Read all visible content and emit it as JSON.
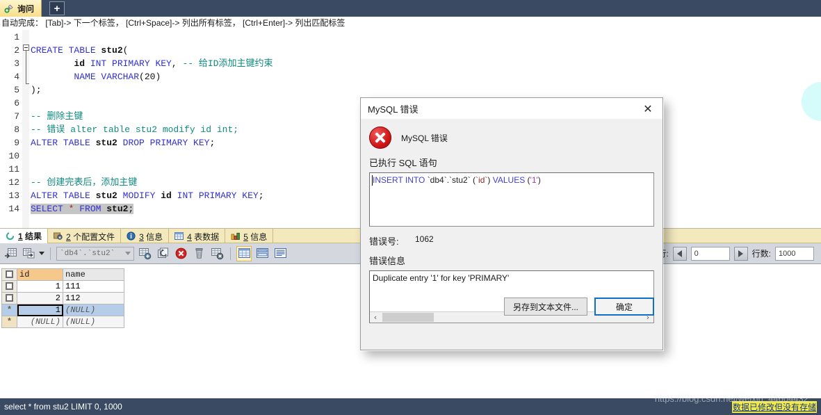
{
  "window": {
    "tab_label": "询问",
    "tab_icon": "plug-icon",
    "add_tab_label": "+"
  },
  "hint_bar": {
    "text": "自动完成： [Tab]-> 下一个标签， [Ctrl+Space]-> 列出所有标签， [Ctrl+Enter]-> 列出匹配标签"
  },
  "editor": {
    "line_numbers": [
      "1",
      "2",
      "3",
      "4",
      "5",
      "6",
      "7",
      "8",
      "9",
      "10",
      "11",
      "12",
      "13",
      "14"
    ],
    "lines": [
      "",
      "CREATE TABLE stu2(",
      "         id INT PRIMARY KEY, -- 给ID添加主键约束",
      "         NAME VARCHAR(20)",
      ");",
      "",
      "-- 删除主键",
      "-- 错误 alter table stu2 modify id int;",
      "ALTER TABLE stu2 DROP PRIMARY KEY;",
      "",
      "",
      "-- 创建完表后，添加主键",
      "ALTER TABLE stu2 MODIFY id INT PRIMARY KEY;",
      "SELECT * FROM stu2;"
    ],
    "selected_line": 14,
    "colors": {
      "keyword": "#3131d1",
      "comment": "#0f8a7e",
      "identifier": "#111111",
      "selection": "#c5c5c5"
    }
  },
  "results": {
    "tabs": [
      {
        "num": "1",
        "label": "结果",
        "icon": "spinner-icon",
        "active": true
      },
      {
        "num": "2",
        "label": "个配置文件",
        "icon": "profile-icon",
        "active": false
      },
      {
        "num": "3",
        "label": "信息",
        "icon": "info-icon",
        "active": false
      },
      {
        "num": "4",
        "label": "表数据",
        "icon": "grid-icon",
        "active": false
      },
      {
        "num": "5",
        "label": "信息",
        "icon": "chart-icon",
        "active": false
      }
    ],
    "toolbar": {
      "table_selector_value": "`db4`.`stu2`",
      "buttons": [
        "export-grid-icon",
        "import-grid-icon",
        "dropdown-caret-icon",
        "add-row-icon",
        "duplicate-row-icon",
        "delete-row-icon",
        "drop-row-icon",
        "refresh-grid-icon",
        "grid-view-icon",
        "form-view-icon",
        "text-view-icon"
      ]
    },
    "pager": {
      "first_row_label": "一行:",
      "first_row_value": "0",
      "row_count_label": "行数:",
      "row_count_value": "1000",
      "prev_icon": "arrow-left-icon",
      "next_icon": "arrow-right-icon"
    },
    "grid": {
      "columns": [
        "id",
        "name"
      ],
      "rows": [
        {
          "marker": "checkbox",
          "id": "1",
          "name": "111",
          "selected": false,
          "alt": false
        },
        {
          "marker": "checkbox",
          "id": "2",
          "name": "112",
          "selected": false,
          "alt": true
        },
        {
          "marker": "star",
          "id": "1",
          "name": "(NULL)",
          "selected": true,
          "alt": false
        },
        {
          "marker": "star",
          "id": "(NULL)",
          "name": "(NULL)",
          "selected": false,
          "alt": true
        }
      ]
    }
  },
  "dialog": {
    "title": "MySQL 错误",
    "close_icon": "close-icon",
    "error_icon": "error-circle-icon",
    "heading": "MySQL 错误",
    "sql_label": "已执行 SQL 语句",
    "sql_statement": {
      "full": "INSERT INTO `db4`.`stu2` (`id`) VALUES ('1')",
      "parts": [
        {
          "text": "INSERT INTO ",
          "kind": "keyword"
        },
        {
          "text": "`db4`.`stu2` ",
          "kind": "identifier"
        },
        {
          "text": "(",
          "kind": "punct"
        },
        {
          "text": "`id`",
          "kind": "column"
        },
        {
          "text": ") ",
          "kind": "punct"
        },
        {
          "text": "VALUES ",
          "kind": "keyword"
        },
        {
          "text": "(",
          "kind": "punct"
        },
        {
          "text": "'1'",
          "kind": "value"
        },
        {
          "text": ")",
          "kind": "punct"
        }
      ]
    },
    "errno_label": "错误号:",
    "errno_value": "1062",
    "message_label": "错误信息",
    "message_value": "Duplicate entry '1' for key 'PRIMARY'",
    "scrollbar": {
      "left_icon": "‹",
      "right_icon": "›"
    },
    "buttons": {
      "save_to_file": "另存到文本文件...",
      "ok": "确定"
    }
  },
  "status_bar": {
    "query": "select * from stu2 LIMIT 0, 1000",
    "right_notice": "数据已修改但没有存储"
  },
  "watermark": {
    "text": "https://blog.csdn.net/weixin_44604432"
  }
}
